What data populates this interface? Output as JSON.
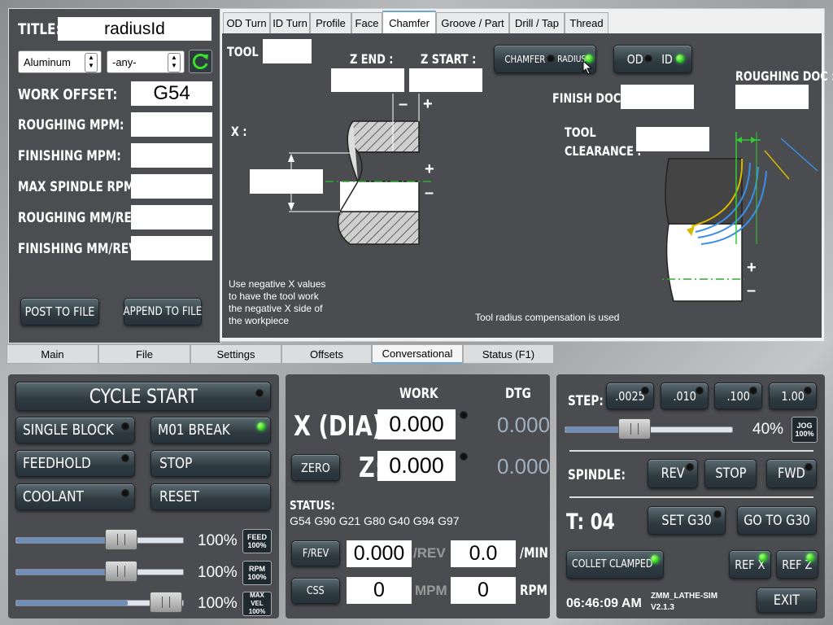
{
  "left_panel": {
    "title_label": "TITLE:",
    "title_value": "radiusId",
    "material_select": "Aluminum",
    "grade_select": "-any-",
    "work_offset_label": "WORK OFFSET:",
    "work_offset_value": "G54",
    "roughing_mpm_label": "ROUGHING MPM:",
    "finishing_mpm_label": "FINISHING MPM:",
    "max_spindle_label": "MAX SPINDLE RPM:",
    "roughing_mmrev_label": "ROUGHING MM/REV:",
    "finishing_mmrev_label": "FINISHING MM/REV:",
    "post_button": "POST TO FILE",
    "append_button": "APPEND TO FILE"
  },
  "conv_tabs": [
    "OD Turn",
    "ID Turn",
    "Profile",
    "Face",
    "Chamfer",
    "Groove / Part",
    "Drill / Tap",
    "Thread"
  ],
  "conv_active_tab": "Chamfer",
  "chamfer": {
    "tool_label": "TOOL :",
    "z_end_label": "Z END :",
    "z_start_label": "Z START :",
    "x_label": "X :",
    "chamfer_label": "CHAMFER",
    "radius_label": "RADIUS",
    "od_label": "OD",
    "id_label": "ID",
    "finish_doc_label": "FINISH DOC :",
    "roughing_doc_label": "ROUGHING DOC :",
    "tool_clearance_label_1": "TOOL",
    "tool_clearance_label_2": "CLEARANCE :",
    "minus": "–",
    "plus": "+",
    "note_negative_x": "Use negative X values to have the tool work the negative X side of the workpiece",
    "note_radius_comp": "Tool radius compensation is used"
  },
  "main_tabs": [
    "Main",
    "File",
    "Settings",
    "Offsets",
    "Conversational",
    "Status (F1)"
  ],
  "main_active_tab": "Conversational",
  "controls": {
    "cycle_start": "CYCLE START",
    "single_block": "SINGLE BLOCK",
    "m01_break": "M01 BREAK",
    "feedhold": "FEEDHOLD",
    "stop": "STOP",
    "coolant": "COOLANT",
    "reset": "RESET",
    "feed_pct": "100%",
    "feed_label_1": "FEED",
    "feed_label_2": "100%",
    "rpm_pct": "100%",
    "rpm_label_1": "RPM",
    "rpm_label_2": "100%",
    "maxvel_pct": "100%",
    "maxvel_label_1": "MAX VEL",
    "maxvel_label_2": "100%",
    "feed_value": 100,
    "rpm_value": 100,
    "maxvel_value": 100
  },
  "dro": {
    "work_header": "WORK",
    "dtg_header": "DTG",
    "x_label": "X (DIA):",
    "x_work": "0.000",
    "x_dtg": "0.000",
    "z_label": "Z:",
    "z_work": "0.000",
    "z_dtg": "0.000",
    "zero_button": "ZERO",
    "status_label": "STATUS:",
    "status_codes": "G54 G90 G21 G80 G40 G94 G97",
    "frev_button": "F/REV",
    "frev_value": "0.000",
    "frev_unit": "/REV",
    "fmin_value": "0.0",
    "fmin_unit": "/MIN",
    "css_button": "CSS",
    "css_value": "0",
    "css_unit": "MPM",
    "rpm_value": "0",
    "rpm_unit": "RPM"
  },
  "jog": {
    "step_label": "STEP:",
    "steps": [
      ".0025",
      ".010",
      ".100",
      "1.00"
    ],
    "jog_pct": "40%",
    "jog_value": 40,
    "jog_btn_1": "JOG",
    "jog_btn_2": "100%",
    "spindle_label": "SPINDLE:",
    "rev": "REV",
    "stop": "STOP",
    "fwd": "FWD",
    "tool_label": "T: 04",
    "set_g30": "SET G30",
    "goto_g30": "GO TO G30",
    "collet": "COLLET CLAMPED",
    "ref_x": "REF X",
    "ref_z": "REF Z",
    "time": "06:46:09 AM",
    "app_name": "ZMM_LATHE-SIM",
    "version": "V2.1.3",
    "exit": "EXIT"
  },
  "colors": {
    "led_on": "#2fd01a",
    "accent_tab": "#6aa8d8",
    "panel": "#4a4c4f"
  }
}
